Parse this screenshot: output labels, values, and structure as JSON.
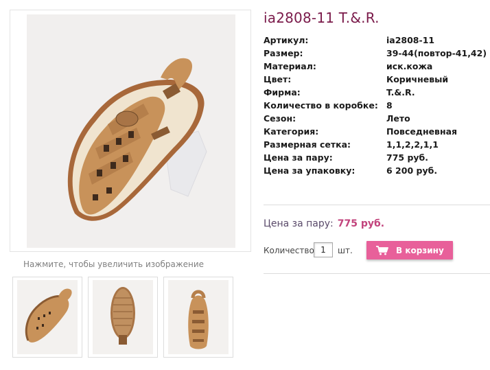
{
  "product": {
    "title": "ia2808-11 T.&.R."
  },
  "specs": [
    {
      "label": "Артикул:",
      "value": "ia2808-11"
    },
    {
      "label": "Размер:",
      "value": "39-44(повтор-41,42)"
    },
    {
      "label": "Материал:",
      "value": "иск.кожа"
    },
    {
      "label": "Цвет:",
      "value": "Коричневый"
    },
    {
      "label": "Фирма:",
      "value": "T.&.R."
    },
    {
      "label": "Количество в коробке:",
      "value": "8"
    },
    {
      "label": "Сезон:",
      "value": "Лето"
    },
    {
      "label": "Категория:",
      "value": "Повседневная"
    },
    {
      "label": "Размерная сетка:",
      "value": "1,1,2,2,1,1"
    },
    {
      "label": "Цена за пару:",
      "value": "775 руб."
    },
    {
      "label": "Цена за упаковку:",
      "value": "6 200 руб."
    }
  ],
  "price": {
    "label": "Цена за пару:",
    "value": "775 руб."
  },
  "order": {
    "qty_label": "Количество",
    "qty_value": "1",
    "unit": "шт.",
    "cart_label": "В корзину"
  },
  "gallery": {
    "zoom_hint": "Нажмите, чтобы увеличить изображение",
    "thumbnails": [
      "sandal-side-view",
      "sandal-sole-view",
      "sandal-front-view"
    ]
  },
  "colors": {
    "title": "#7a1a4a",
    "price_accent": "#c2437c",
    "cart_button": "#e8609a",
    "leather": "#c8925a"
  },
  "icons": {
    "cart": "shopping-cart-icon"
  }
}
